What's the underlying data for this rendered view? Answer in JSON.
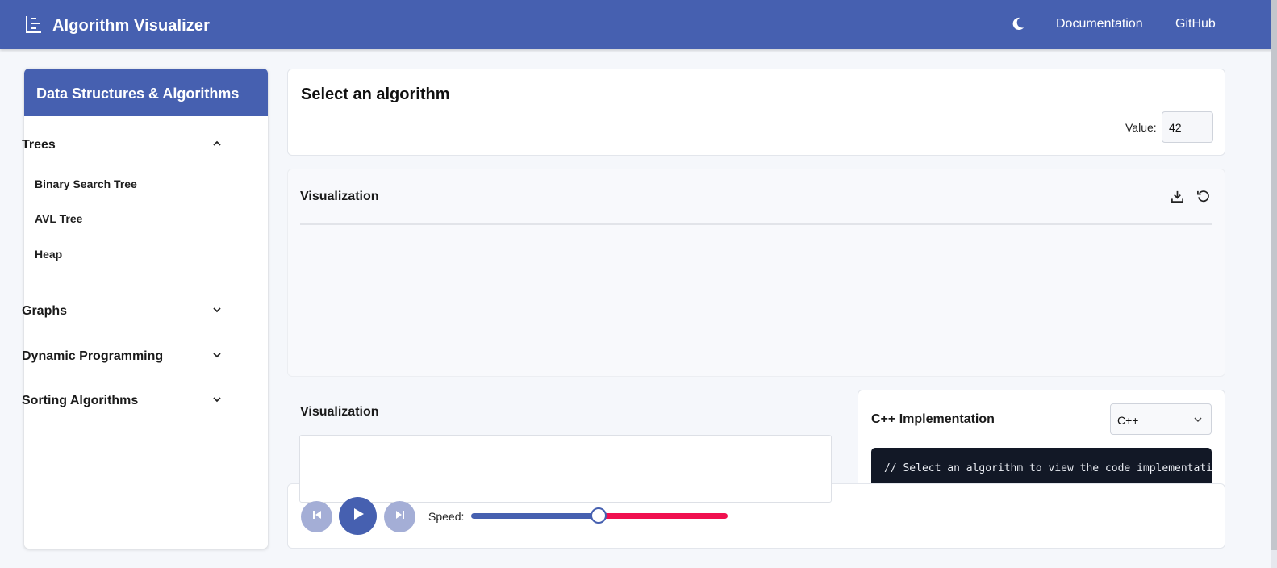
{
  "header": {
    "title": "Algorithm Visualizer",
    "logo_icon": "bar-list-icon",
    "theme_icon": "moon-icon",
    "links": [
      "Documentation",
      "GitHub"
    ]
  },
  "sidebar": {
    "heading": "Data Structures & Algorithms",
    "sections": [
      {
        "label": "Trees",
        "expanded": true,
        "items": [
          "Binary Search Tree",
          "AVL Tree",
          "Heap"
        ]
      },
      {
        "label": "Graphs",
        "expanded": false
      },
      {
        "label": "Dynamic Programming",
        "expanded": false
      },
      {
        "label": "Sorting Algorithms",
        "expanded": false
      }
    ]
  },
  "main": {
    "select_title": "Select an algorithm",
    "value_label": "Value:",
    "value_input": "42",
    "visualization_title": "Visualization",
    "secondary_visualization_title": "Visualization",
    "code": {
      "title": "C++ Implementation",
      "language": "C++",
      "placeholder_line": "// Select an algorithm to view the code implementation"
    },
    "controls": {
      "speed_label": "Speed:",
      "speed": 0.5
    }
  },
  "colors": {
    "brand": "#4660b0",
    "slider_remaining": "#f0104f",
    "disabled_button": "#a4aed6",
    "code_bg": "#121826"
  }
}
